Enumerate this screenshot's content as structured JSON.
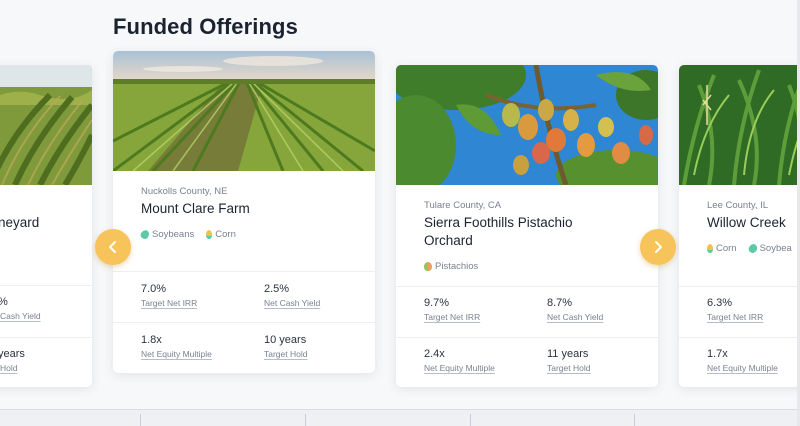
{
  "section": {
    "title": "Funded Offerings"
  },
  "carousel": {
    "prev_icon": "chevron-left-icon",
    "next_icon": "chevron-right-icon",
    "accent_color": "#f6c45a"
  },
  "cards": [
    {
      "location": "",
      "name": "neyard",
      "tags": [],
      "metrics": [
        {
          "value": "",
          "label": ""
        },
        {
          "value": "%",
          "label": "Cash Yield"
        },
        {
          "value": "",
          "label": ""
        },
        {
          "value": "years",
          "label": "Hold"
        }
      ]
    },
    {
      "location": "Nuckolls County, NE",
      "name": "Mount Clare Farm",
      "tags": [
        {
          "label": "Soybeans",
          "icon": "soybean-icon",
          "color": "#5cc9a7"
        },
        {
          "label": "Corn",
          "icon": "corn-icon",
          "color": "#f2c14e"
        }
      ],
      "metrics": [
        {
          "value": "7.0%",
          "label": "Target Net IRR"
        },
        {
          "value": "2.5%",
          "label": "Net Cash Yield"
        },
        {
          "value": "1.8x",
          "label": "Net Equity Multiple"
        },
        {
          "value": "10 years",
          "label": "Target Hold"
        }
      ]
    },
    {
      "location": "Tulare County, CA",
      "name_line1": "Sierra Foothills Pistachio",
      "name_line2": "Orchard",
      "tags": [
        {
          "label": "Pistachios",
          "icon": "pistachio-icon",
          "color": "#e8a15c"
        }
      ],
      "metrics": [
        {
          "value": "9.7%",
          "label": "Target Net IRR"
        },
        {
          "value": "8.7%",
          "label": "Net Cash Yield"
        },
        {
          "value": "2.4x",
          "label": "Net Equity Multiple"
        },
        {
          "value": "11 years",
          "label": "Target Hold"
        }
      ]
    },
    {
      "location": "Lee County, IL",
      "name": "Willow Creek",
      "tags": [
        {
          "label": "Corn",
          "icon": "corn-icon",
          "color": "#f2c14e"
        },
        {
          "label": "Soybea",
          "icon": "soybean-icon",
          "color": "#5cc9a7"
        }
      ],
      "metrics": [
        {
          "value": "6.3%",
          "label": "Target Net IRR"
        },
        {
          "value": "",
          "label": ""
        },
        {
          "value": "1.7x",
          "label": "Net Equity Multiple"
        },
        {
          "value": "",
          "label": ""
        }
      ]
    }
  ]
}
